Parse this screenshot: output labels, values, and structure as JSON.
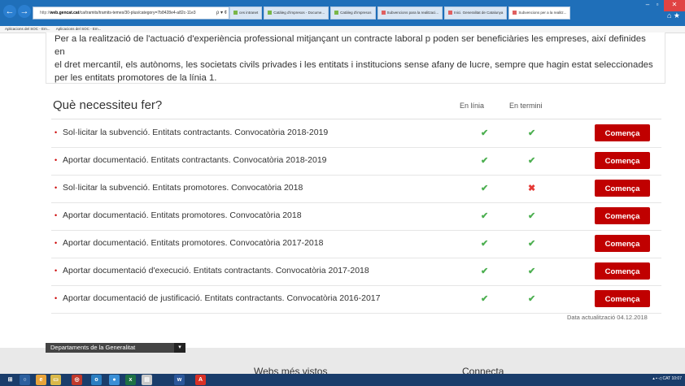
{
  "browser": {
    "url_prefix": "http://",
    "url_domain": "web.gencat.cat",
    "url_path": "/ca/tramits/tramits-temes/30-plus/category=7b8428e4-a82c-11e3",
    "address_icons": "ρ ▾ ¢",
    "tabs": [
      {
        "label": "ces intranet",
        "icon_color": "#7ab648",
        "active": false
      },
      {
        "label": "Catàleg d'impresos - Docume...",
        "icon_color": "#7ab648",
        "active": false
      },
      {
        "label": "Catàleg d'impresos",
        "icon_color": "#7ab648",
        "active": false
      },
      {
        "label": "Subvencions para la realitzaci...",
        "icon_color": "#e06060",
        "active": false
      },
      {
        "label": "Inici. Generalitat de Catalunya",
        "icon_color": "#e06060",
        "active": false
      },
      {
        "label": "Subvencions per a la realitz...",
        "icon_color": "#e06060",
        "active": true
      }
    ],
    "favorites": [
      "Aplicacions del SOC - Em...",
      "Aplicacions del SOC - Em..."
    ]
  },
  "intro": {
    "line1": "Per a la realització de l'actuació d'experiència professional mitjançant un contracte laboral p poden ser beneficiàries les empreses, així definides en",
    "line2": "el dret mercantil, els autònoms, les societats civils privades i les entitats i institucions sense afany de lucre, sempre que hagin estat seleccionades",
    "line3": "per les entitats promotores de la línia 1."
  },
  "section": {
    "title": "Què necessiteu fer?",
    "col_online": "En línia",
    "col_deadline": "En termini"
  },
  "procedures": [
    {
      "label": "Sol·licitar la subvenció. Entitats contractants. Convocatòria 2018-2019",
      "online": "✔",
      "deadline": "✔",
      "deadline_ok": true,
      "button": "Comença"
    },
    {
      "label": "Aportar documentació. Entitats contractants. Convocatòria 2018-2019",
      "online": "✔",
      "deadline": "✔",
      "deadline_ok": true,
      "button": "Comença"
    },
    {
      "label": "Sol·licitar la subvenció. Entitats promotores. Convocatòria 2018",
      "online": "✔",
      "deadline": "✖",
      "deadline_ok": false,
      "button": "Comença"
    },
    {
      "label": "Aportar documentació. Entitats promotores. Convocatòria 2018",
      "online": "✔",
      "deadline": "✔",
      "deadline_ok": true,
      "button": "Comença"
    },
    {
      "label": "Aportar documentació. Entitats promotores. Convocatòria 2017-2018",
      "online": "✔",
      "deadline": "✔",
      "deadline_ok": true,
      "button": "Comença"
    },
    {
      "label": "Aportar documentació d'execució. Entitats contractants. Convocatòria 2017-2018",
      "online": "✔",
      "deadline": "✔",
      "deadline_ok": true,
      "button": "Comença"
    },
    {
      "label": "Aportar documentació de justificació. Entitats contractants. Convocatòria 2016-2017",
      "online": "✔",
      "deadline": "✔",
      "deadline_ok": true,
      "button": "Comença"
    }
  ],
  "updated": "Data actualització 04.12.2018",
  "footer": {
    "departments_select": "Departaments de la Generalitat",
    "webs": "Webs més vistos",
    "connect": "Connecta"
  },
  "taskbar": {
    "tray_text": "CAT",
    "clock": "10:07"
  },
  "colors": {
    "accent": "#c00000",
    "ok": "#4caf50",
    "error": "#e53935",
    "chrome": "#1f6fb9"
  }
}
